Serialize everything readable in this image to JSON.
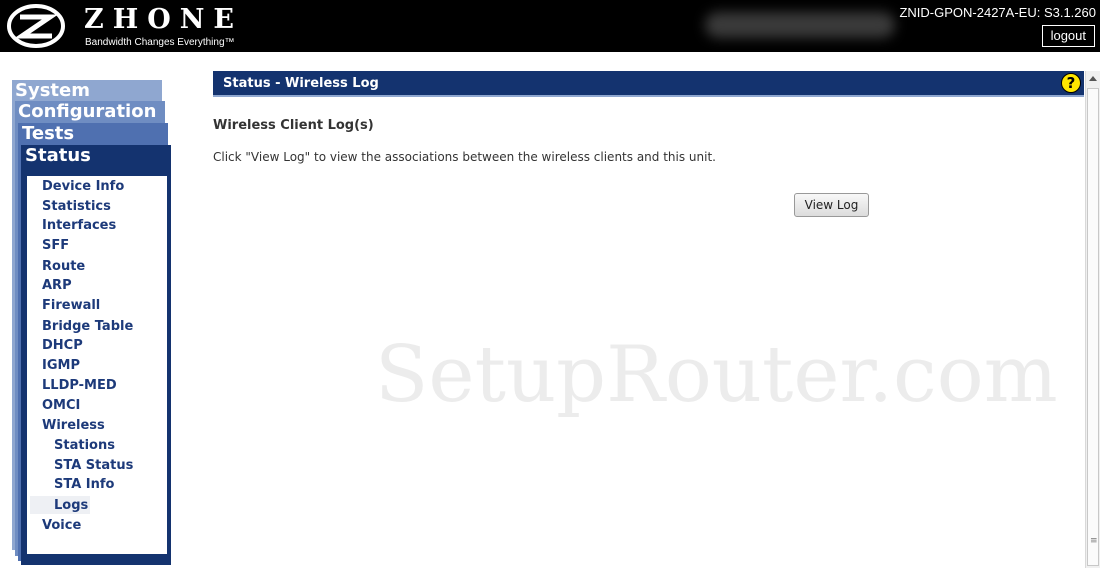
{
  "header": {
    "brand_name": "ZHONE",
    "tagline": "Bandwidth Changes Everything™",
    "device_id": "ZNID-GPON-2427A-EU: S3.1.260",
    "logout_label": "logout"
  },
  "sidebar": {
    "tabs": [
      "System",
      "Configuration",
      "Tests",
      "Status"
    ],
    "items": [
      {
        "label": "Device Info"
      },
      {
        "label": "Statistics"
      },
      {
        "label": "Interfaces"
      },
      {
        "label": "SFF"
      },
      {
        "label": "Route"
      },
      {
        "label": "ARP"
      },
      {
        "label": "Firewall"
      },
      {
        "label": "Bridge Table"
      },
      {
        "label": "DHCP"
      },
      {
        "label": "IGMP"
      },
      {
        "label": "LLDP-MED"
      },
      {
        "label": "OMCI"
      },
      {
        "label": "Wireless"
      },
      {
        "label": "Stations"
      },
      {
        "label": "STA Status"
      },
      {
        "label": "STA Info"
      },
      {
        "label": "Logs"
      },
      {
        "label": "Voice"
      }
    ],
    "active_item": "Logs"
  },
  "main": {
    "title": "Status - Wireless Log",
    "help_symbol": "?",
    "heading": "Wireless Client Log(s)",
    "description": "Click \"View Log\" to view the associations between the wireless clients and this unit.",
    "view_log_label": "View Log",
    "watermark": "SetupRouter.com"
  },
  "colors": {
    "header_bg": "#000000",
    "title_bar": "#14336f",
    "menu_text": "#1d3a7a",
    "help_icon": "#ffe600"
  }
}
